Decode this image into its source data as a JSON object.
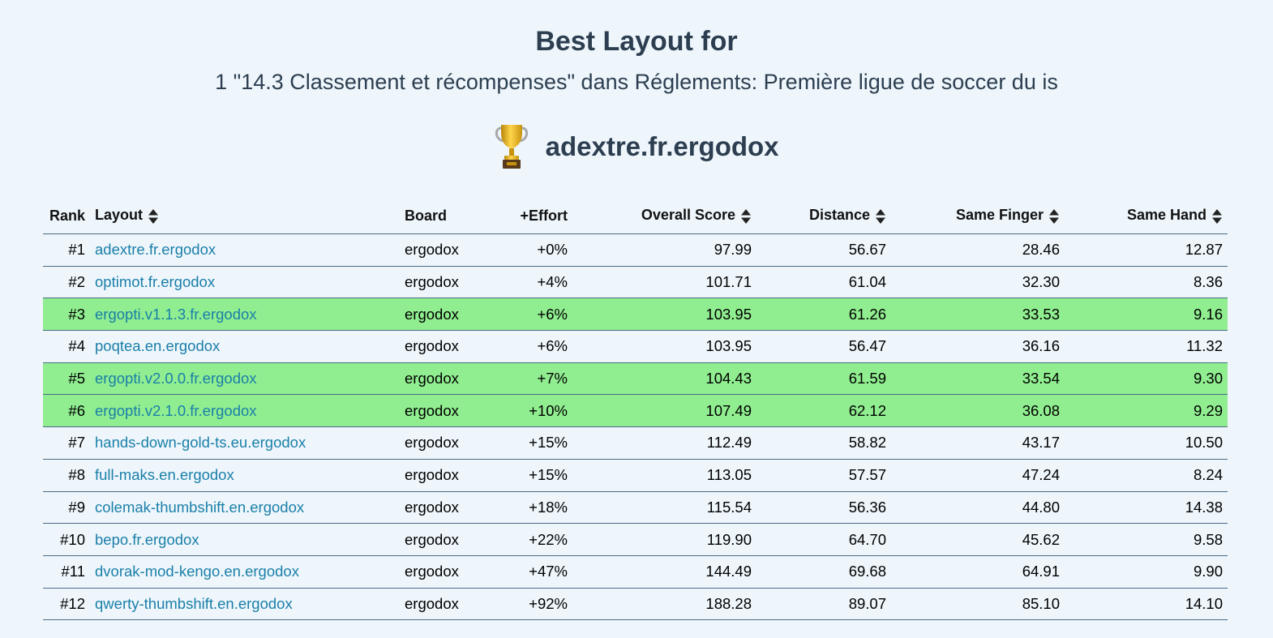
{
  "header": {
    "title": "Best Layout for",
    "subtitle": "1 \"14.3 Classement et récompenses\" dans Réglements: Première ligue de soccer du is",
    "winner_icon": "trophy-icon",
    "winner_name": "adextre.fr.ergodox"
  },
  "table": {
    "columns": {
      "rank": "Rank",
      "layout": "Layout",
      "board": "Board",
      "effort": "+Effort",
      "overall": "Overall Score",
      "distance": "Distance",
      "same_finger": "Same Finger",
      "same_hand": "Same Hand"
    },
    "highlight_color": "#90ee90",
    "link_color": "#1a7fa8",
    "rows": [
      {
        "rank": "#1",
        "layout": "adextre.fr.ergodox",
        "board": "ergodox",
        "effort": "+0%",
        "overall": "97.99",
        "distance": "56.67",
        "same_finger": "28.46",
        "same_hand": "12.87",
        "highlighted": false
      },
      {
        "rank": "#2",
        "layout": "optimot.fr.ergodox",
        "board": "ergodox",
        "effort": "+4%",
        "overall": "101.71",
        "distance": "61.04",
        "same_finger": "32.30",
        "same_hand": "8.36",
        "highlighted": false
      },
      {
        "rank": "#3",
        "layout": "ergopti.v1.1.3.fr.ergodox",
        "board": "ergodox",
        "effort": "+6%",
        "overall": "103.95",
        "distance": "61.26",
        "same_finger": "33.53",
        "same_hand": "9.16",
        "highlighted": true
      },
      {
        "rank": "#4",
        "layout": "poqtea.en.ergodox",
        "board": "ergodox",
        "effort": "+6%",
        "overall": "103.95",
        "distance": "56.47",
        "same_finger": "36.16",
        "same_hand": "11.32",
        "highlighted": false
      },
      {
        "rank": "#5",
        "layout": "ergopti.v2.0.0.fr.ergodox",
        "board": "ergodox",
        "effort": "+7%",
        "overall": "104.43",
        "distance": "61.59",
        "same_finger": "33.54",
        "same_hand": "9.30",
        "highlighted": true
      },
      {
        "rank": "#6",
        "layout": "ergopti.v2.1.0.fr.ergodox",
        "board": "ergodox",
        "effort": "+10%",
        "overall": "107.49",
        "distance": "62.12",
        "same_finger": "36.08",
        "same_hand": "9.29",
        "highlighted": true
      },
      {
        "rank": "#7",
        "layout": "hands-down-gold-ts.eu.ergodox",
        "board": "ergodox",
        "effort": "+15%",
        "overall": "112.49",
        "distance": "58.82",
        "same_finger": "43.17",
        "same_hand": "10.50",
        "highlighted": false
      },
      {
        "rank": "#8",
        "layout": "full-maks.en.ergodox",
        "board": "ergodox",
        "effort": "+15%",
        "overall": "113.05",
        "distance": "57.57",
        "same_finger": "47.24",
        "same_hand": "8.24",
        "highlighted": false
      },
      {
        "rank": "#9",
        "layout": "colemak-thumbshift.en.ergodox",
        "board": "ergodox",
        "effort": "+18%",
        "overall": "115.54",
        "distance": "56.36",
        "same_finger": "44.80",
        "same_hand": "14.38",
        "highlighted": false
      },
      {
        "rank": "#10",
        "layout": "bepo.fr.ergodox",
        "board": "ergodox",
        "effort": "+22%",
        "overall": "119.90",
        "distance": "64.70",
        "same_finger": "45.62",
        "same_hand": "9.58",
        "highlighted": false
      },
      {
        "rank": "#11",
        "layout": "dvorak-mod-kengo.en.ergodox",
        "board": "ergodox",
        "effort": "+47%",
        "overall": "144.49",
        "distance": "69.68",
        "same_finger": "64.91",
        "same_hand": "9.90",
        "highlighted": false
      },
      {
        "rank": "#12",
        "layout": "qwerty-thumbshift.en.ergodox",
        "board": "ergodox",
        "effort": "+92%",
        "overall": "188.28",
        "distance": "89.07",
        "same_finger": "85.10",
        "same_hand": "14.10",
        "highlighted": false
      }
    ]
  }
}
